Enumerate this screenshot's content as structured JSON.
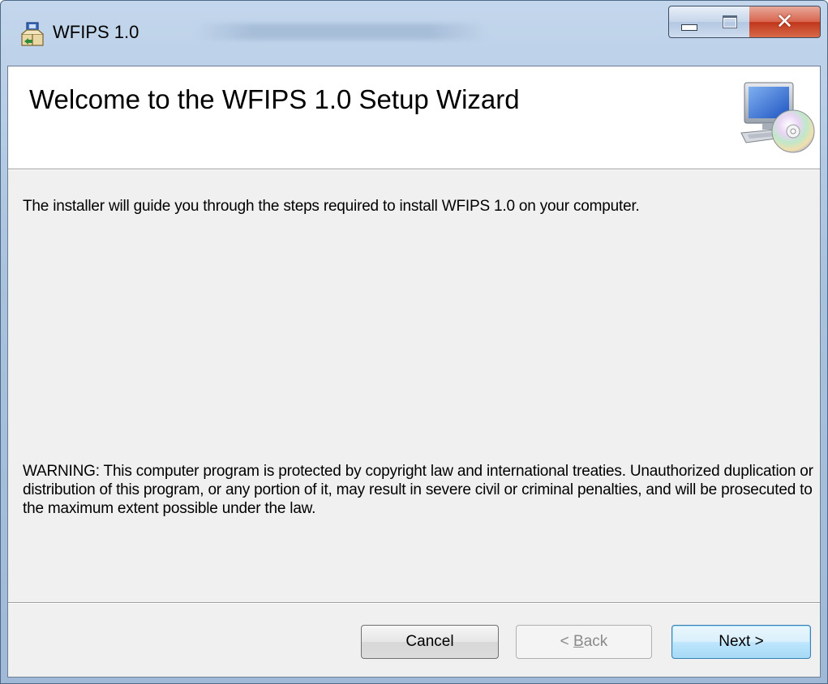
{
  "window": {
    "title": "WFIPS 1.0"
  },
  "header": {
    "title": "Welcome to the WFIPS 1.0 Setup Wizard"
  },
  "body": {
    "intro": "The installer will guide you through the steps required to install WFIPS 1.0 on your computer.",
    "warning": "WARNING: This computer program is protected by copyright law and international treaties. Unauthorized duplication or distribution of this program, or any portion of it, may result in severe civil or criminal penalties, and will be prosecuted to the maximum extent possible under the law."
  },
  "buttons": {
    "cancel": "Cancel",
    "back_prefix": "< ",
    "back_accel": "B",
    "back_rest": "ack",
    "next": "Next >"
  },
  "icons": {
    "app": "installer-package-icon",
    "banner": "computer-cd-icon",
    "minimize": "minimize-icon",
    "maximize": "maximize-icon",
    "close": "close-icon"
  },
  "colors": {
    "titlebar": "#a9c2de",
    "client_background": "#f0f0f0",
    "banner_background": "#ffffff",
    "close_button": "#c2361b",
    "default_button_border": "#3c7fb1"
  }
}
